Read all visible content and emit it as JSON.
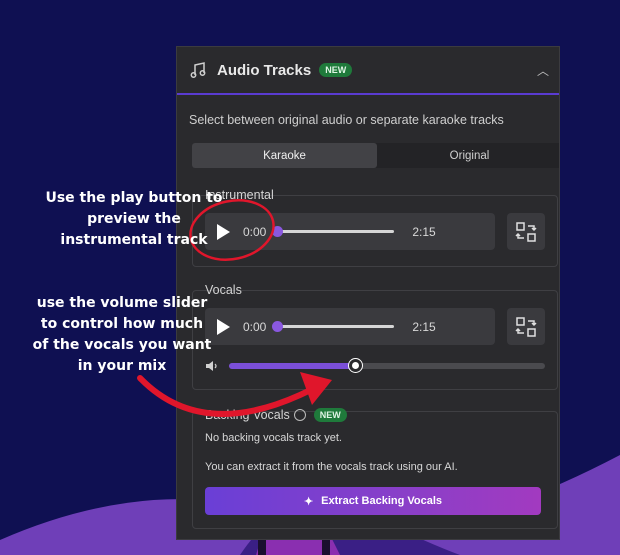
{
  "panel": {
    "title": "Audio Tracks",
    "title_badge": "NEW",
    "subtitle": "Select between original audio or separate karaoke tracks",
    "tabs": [
      {
        "label": "Karaoke",
        "active": true
      },
      {
        "label": "Original",
        "active": false
      }
    ],
    "instrumental": {
      "label": "Instrumental",
      "current_time": "0:00",
      "duration": "2:15",
      "progress": 0
    },
    "vocals": {
      "label": "Vocals",
      "current_time": "0:00",
      "duration": "2:15",
      "progress": 0,
      "volume": 0.4
    },
    "backing": {
      "label": "Backing Vocals",
      "badge": "NEW",
      "empty_text": "No backing vocals track yet.",
      "help_text": "You can extract it from the vocals track using our AI.",
      "button_label": "Extract Backing Vocals"
    }
  },
  "annotations": {
    "play_note": [
      "Use the play button to",
      "preview the",
      "instrumental track"
    ],
    "volume_note": [
      "use the volume slider",
      "to control how much",
      "of the vocals you want",
      "in your mix"
    ]
  },
  "colors": {
    "background": "#0f1052",
    "panel": "#2a2a2d",
    "accent_purple": "#7b4fd8",
    "badge_green": "#1f7a3b",
    "annotation_red": "#e0162b"
  },
  "icons": {
    "header": "music-note-icon",
    "collapse": "chevron-up-icon",
    "play": "play-icon",
    "swap": "swap-track-icon",
    "volume": "speaker-icon",
    "sparkle": "sparkle-icon"
  }
}
